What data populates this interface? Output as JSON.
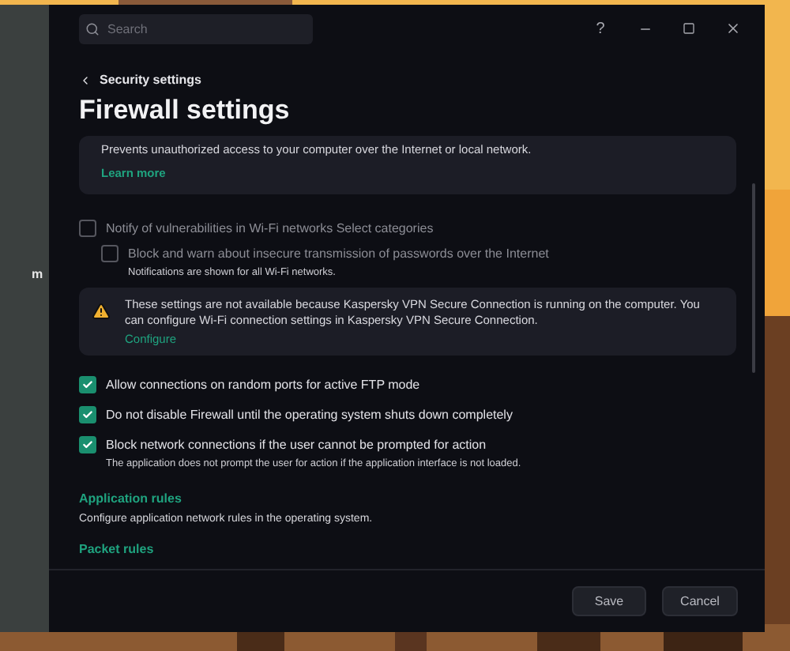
{
  "background_window": {
    "text": "m"
  },
  "window": {
    "search": {
      "placeholder": "Search"
    },
    "help": "?"
  },
  "breadcrumb": "Security settings",
  "title": "Firewall settings",
  "intro_card": {
    "text": "Prevents unauthorized access to your computer over the Internet or local network.",
    "link": "Learn more"
  },
  "wifi_option": {
    "label": "Notify of vulnerabilities in Wi-Fi networks Select categories",
    "checked": false,
    "disabled": true,
    "children": [
      {
        "label": "Block and warn about insecure transmission of passwords over the Internet",
        "checked": false,
        "disabled": true,
        "note": "Notifications are shown for all Wi-Fi networks."
      }
    ]
  },
  "warning": {
    "text": "These settings are not available because Kaspersky VPN Secure Connection is running on the computer. You can configure Wi-Fi connection settings in Kaspersky VPN Secure Connection.",
    "link": "Configure"
  },
  "options": [
    {
      "label": "Allow connections on random ports for active FTP mode",
      "checked": true,
      "disabled": false
    },
    {
      "label": "Do not disable Firewall until the operating system shuts down completely",
      "checked": true,
      "disabled": false
    },
    {
      "label": "Block network connections if the user cannot be prompted for action",
      "checked": true,
      "disabled": false,
      "note": "The application does not prompt the user for action if the application interface is not loaded."
    }
  ],
  "sections": [
    {
      "title": "Application rules",
      "description": "Configure application network rules in the operating system."
    },
    {
      "title": "Packet rules"
    }
  ],
  "buttons": [
    "Save",
    "Cancel"
  ]
}
